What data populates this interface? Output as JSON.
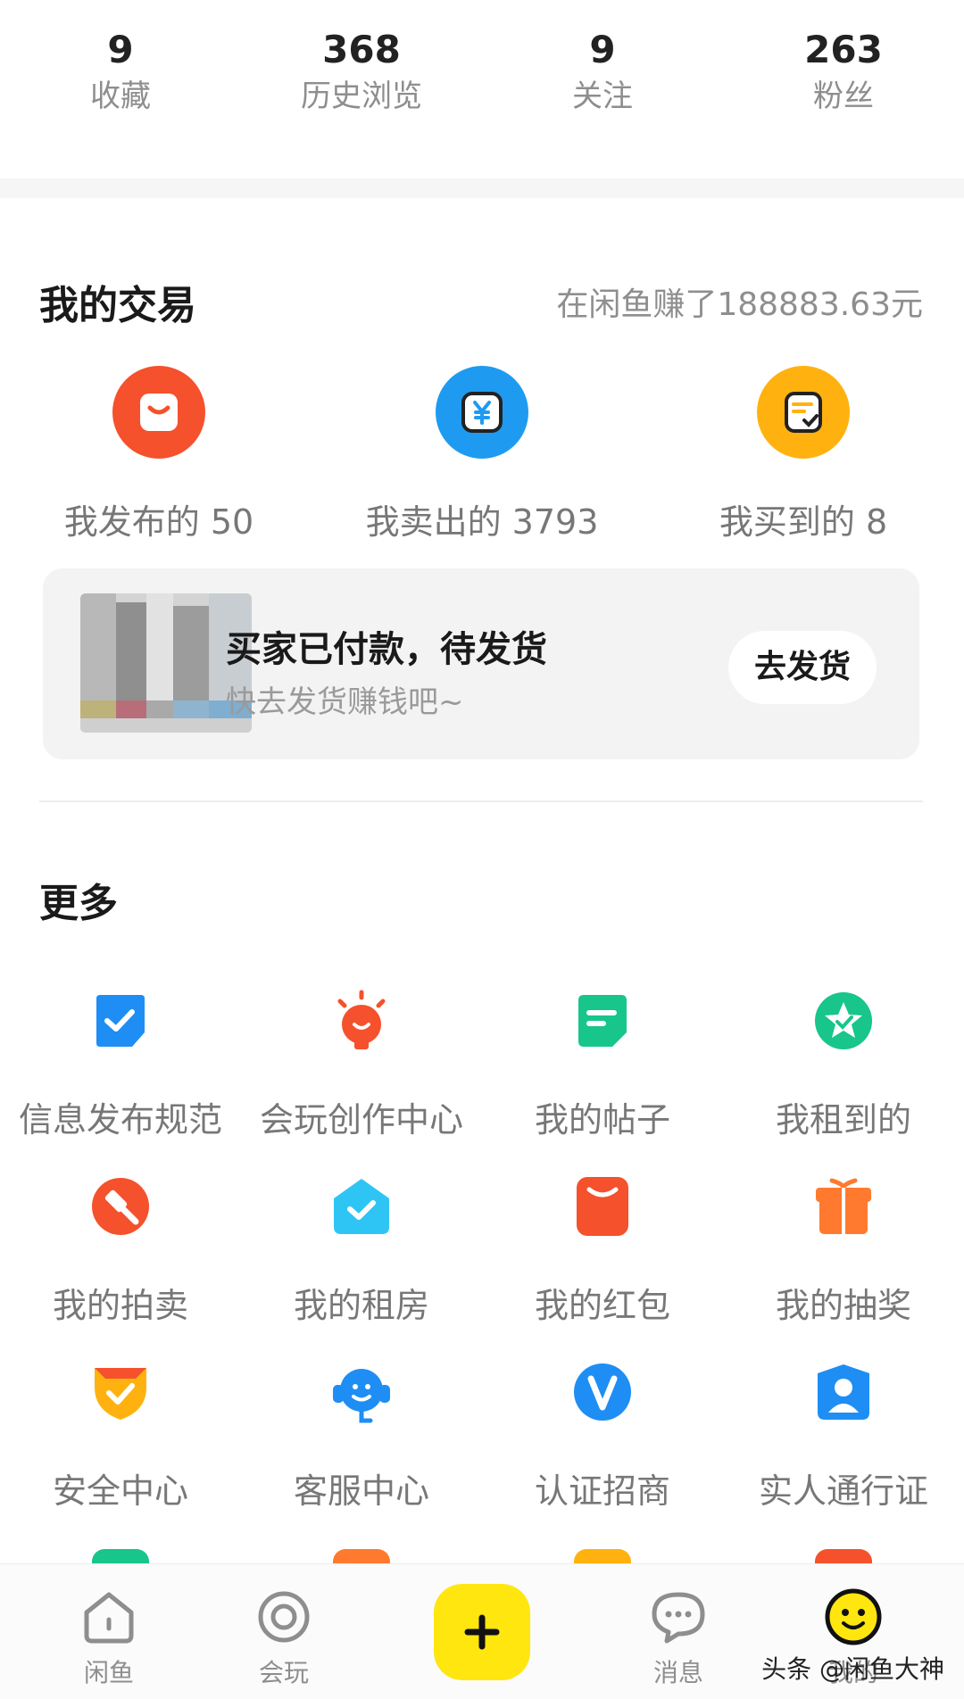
{
  "stats": [
    {
      "value": "9",
      "label": "收藏"
    },
    {
      "value": "368",
      "label": "历史浏览"
    },
    {
      "value": "9",
      "label": "关注"
    },
    {
      "value": "263",
      "label": "粉丝"
    }
  ],
  "trade": {
    "title": "我的交易",
    "earned": "在闲鱼赚了188883.63元",
    "items": [
      {
        "label": "我发布的 50",
        "icon": "bag-icon",
        "color": "#f5512c"
      },
      {
        "label": "我卖出的 3793",
        "icon": "yuan-icon",
        "color": "#1e9bf0"
      },
      {
        "label": "我买到的 8",
        "icon": "receipt-icon",
        "color": "#ffb20f"
      }
    ]
  },
  "pending": {
    "title": "买家已付款，待发货",
    "subtitle": "快去发货赚钱吧~",
    "button": "去发货"
  },
  "more": {
    "title": "更多",
    "items": [
      {
        "label": "信息发布规范",
        "icon": "check-doc-icon",
        "color": "#1e8ef5"
      },
      {
        "label": "会玩创作中心",
        "icon": "lightbulb-icon",
        "color": "#f5512c"
      },
      {
        "label": "我的帖子",
        "icon": "post-icon",
        "color": "#18c58a"
      },
      {
        "label": "我租到的",
        "icon": "star-badge-icon",
        "color": "#18c58a"
      },
      {
        "label": "我的拍卖",
        "icon": "gavel-icon",
        "color": "#f5512c"
      },
      {
        "label": "我的租房",
        "icon": "house-check-icon",
        "color": "#2ec5f5"
      },
      {
        "label": "我的红包",
        "icon": "red-packet-icon",
        "color": "#f5512c"
      },
      {
        "label": "我的抽奖",
        "icon": "gift-icon",
        "color": "#ff7a2e"
      },
      {
        "label": "安全中心",
        "icon": "shield-icon",
        "color": "#ffb20f"
      },
      {
        "label": "客服中心",
        "icon": "headset-icon",
        "color": "#1e8ef5"
      },
      {
        "label": "认证招商",
        "icon": "verified-v-icon",
        "color": "#1e8ef5"
      },
      {
        "label": "实人通行证",
        "icon": "person-badge-icon",
        "color": "#1e8ef5"
      }
    ]
  },
  "tabbar": {
    "home": "闲鱼",
    "play": "会玩",
    "messages": "消息",
    "me": "我的"
  },
  "watermark": "头条 @闲鱼大神",
  "colors": {
    "brand_yellow": "#ffe60f",
    "text_gray": "#8e8e8e"
  }
}
